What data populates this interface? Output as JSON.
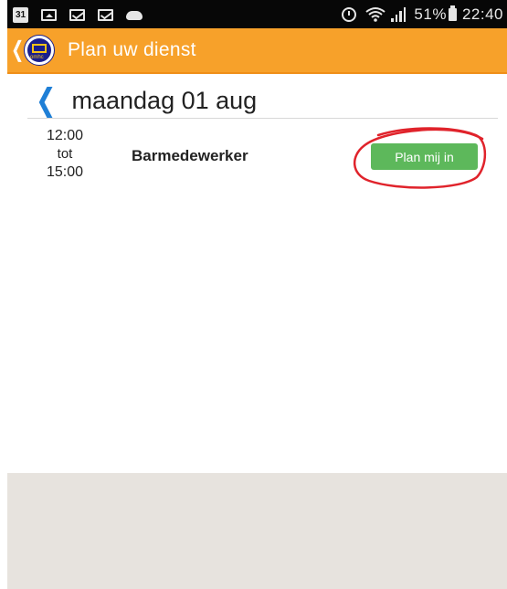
{
  "status_bar": {
    "icons_left": [
      "calendar-icon",
      "image-icon",
      "mail-icon",
      "mail-icon",
      "cloud-icon"
    ],
    "calendar_day": "31",
    "icons_right": [
      "alarm-icon",
      "wifi-icon",
      "signal-icon"
    ],
    "battery": "51%",
    "time": "22:40"
  },
  "app_bar": {
    "title": "Plan uw dienst",
    "logo_text": "omhc",
    "color": "#f7a12a"
  },
  "date_header": {
    "back_icon": "chevron-left-icon",
    "title": "maandag 01 aug"
  },
  "shifts": [
    {
      "start": "12:00",
      "separator": "tot",
      "end": "15:00",
      "role": "Barmedewerker",
      "button_label": "Plan mij in",
      "button_color": "#5db85b"
    }
  ],
  "annotation": {
    "shape": "hand-drawn ellipse",
    "color": "#e0232b"
  },
  "colors": {
    "accent": "#f7a12a",
    "link": "#1f7fd6",
    "panel": "#e7e3de"
  }
}
